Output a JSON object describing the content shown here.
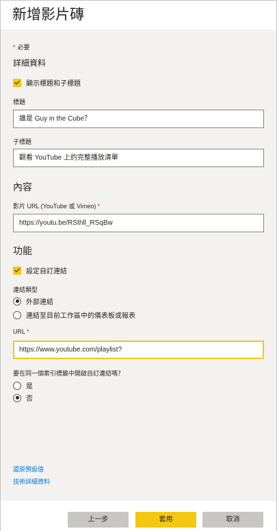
{
  "header": {
    "title": "新增影片磚"
  },
  "form": {
    "required_note": "必要",
    "required_star": "*",
    "details_section": "詳細資料",
    "show_title_checkbox": "顯示標題和子標題",
    "title_label": "標題",
    "title_value": "誰是 Guy in the Cube？",
    "subtitle_label": "子標題",
    "subtitle_value": "觀看 YouTube 上的完整播放清單",
    "content_section": "內容",
    "video_url_label": "影片 URL (YouTube 或 Vimeo)",
    "video_url_value": "https://youtu.be/RSthll_RSqBw",
    "function_section": "功能",
    "custom_link_checkbox": "設定自訂連結",
    "link_type_label": "連結類型",
    "link_type_options": [
      "外部連結",
      "連結至目前工作區中的儀表板或報表"
    ],
    "url_label": "URL",
    "url_value": "https://www.youtube.com/playlist?",
    "open_same_tab_label": "要在同一個索引標籤中開啟自訂連結嗎？",
    "open_same_tab_options": [
      "是",
      "否"
    ],
    "restore_defaults_link": "還原預設值",
    "tech_details_link": "技術詳細資料"
  },
  "footer": {
    "back_label": "上一步",
    "apply_label": "套用",
    "cancel_label": "取消"
  },
  "colors": {
    "accent": "#f2c811",
    "required": "#a4262c",
    "link": "#0078d4",
    "panel_bg": "#f3f2f1"
  }
}
